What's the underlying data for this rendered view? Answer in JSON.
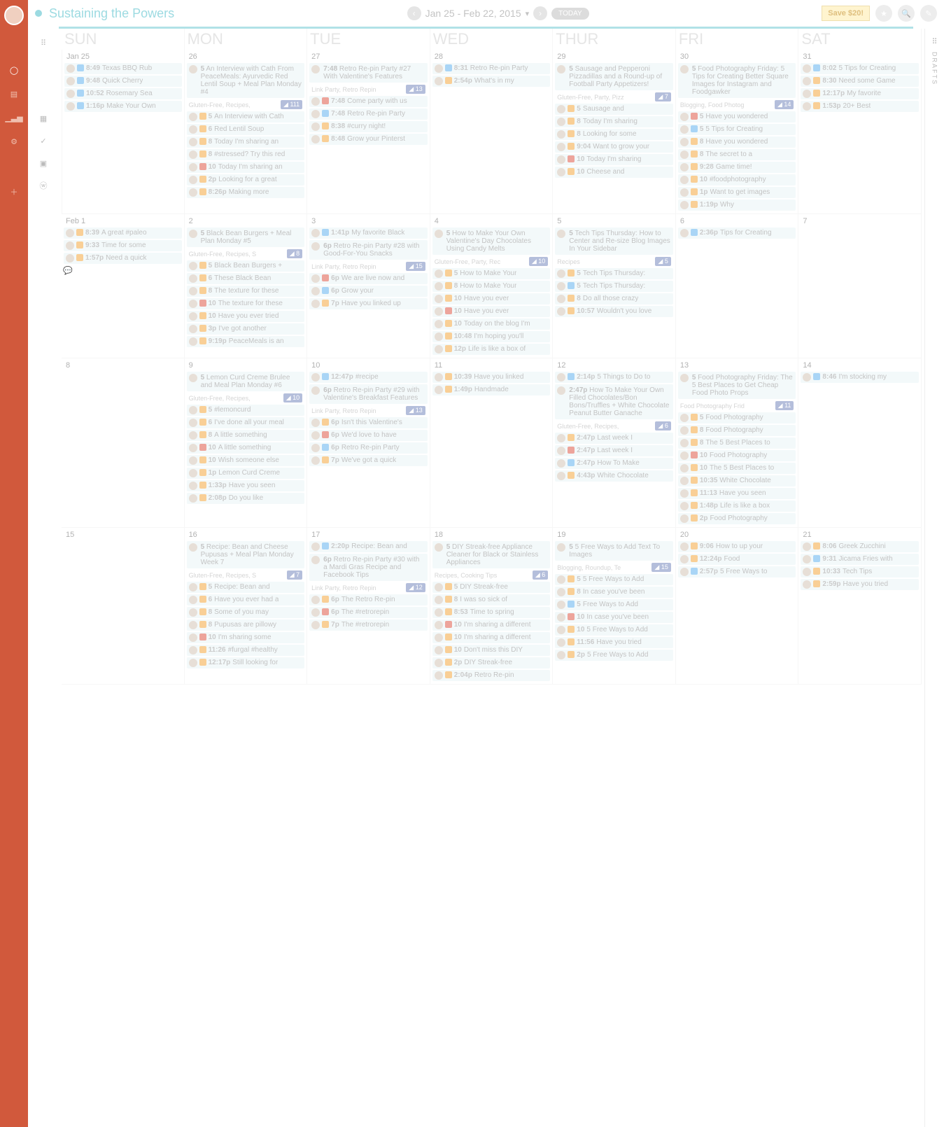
{
  "site_title": "Sustaining the Powers",
  "date_range": "Jan 25 - Feb 22, 2015",
  "today_label": "TODAY",
  "save_label": "Save $20!",
  "drafts_label": "DRAFTS",
  "weekdays": [
    "SUN",
    "MON",
    "TUE",
    "WED",
    "THUR",
    "FRI",
    "SAT"
  ],
  "weeks": [
    {
      "days": [
        {
          "label": "Jan 25",
          "items": [
            {
              "t": "8:49",
              "txt": "Texas BBQ Rub",
              "ic": "tw"
            },
            {
              "t": "9:48",
              "txt": "Quick Cherry",
              "ic": "tw"
            },
            {
              "t": "10:52",
              "txt": "Rosemary Sea",
              "ic": "tw"
            },
            {
              "t": "1:16p",
              "txt": "Make Your Own",
              "ic": "tw"
            }
          ]
        },
        {
          "label": "26",
          "feat": {
            "n": "5",
            "txt": "An Interview with Cath From PeaceMeals: Ayurvedic Red Lentil Soup + Meal Plan Monday #4"
          },
          "tags": "Gluten-Free, Recipes,",
          "badge": "111",
          "items": [
            {
              "t": "5",
              "txt": "An Interview with Cath"
            },
            {
              "t": "6",
              "txt": "Red Lentil Soup"
            },
            {
              "t": "8",
              "txt": "Today I'm sharing an"
            },
            {
              "t": "8",
              "txt": "#stressed? Try this red"
            },
            {
              "t": "10",
              "txt": "Today I'm sharing an",
              "ic": "gp"
            },
            {
              "t": "2p",
              "txt": "Looking for a great"
            },
            {
              "t": "8:26p",
              "txt": "Making more"
            }
          ]
        },
        {
          "label": "27",
          "feat": {
            "n": "7:48",
            "txt": "Retro Re-pin Party #27 With Valentine's Features"
          },
          "tags": "Link Party, Retro Repin",
          "badge": "13",
          "items": [
            {
              "t": "7:48",
              "txt": "Come party with us",
              "ic": "gp"
            },
            {
              "t": "7:48",
              "txt": "Retro Re-pin Party",
              "ic": "tw"
            },
            {
              "t": "8:38",
              "txt": "#curry night!"
            },
            {
              "t": "8:48",
              "txt": "Grow your Pinterst"
            }
          ]
        },
        {
          "label": "28",
          "items": [
            {
              "t": "8:31",
              "txt": "Retro Re-pin Party",
              "ic": "tw"
            },
            {
              "t": "2:54p",
              "txt": "What's in my"
            }
          ]
        },
        {
          "label": "29",
          "feat": {
            "n": "5",
            "txt": "Sausage and Pepperoni Pizzadillas and a Round-up of Football Party Appetizers!"
          },
          "tags": "Gluten-Free, Party, Pizz",
          "badge": "7",
          "items": [
            {
              "t": "5",
              "txt": "Sausage and"
            },
            {
              "t": "8",
              "txt": "Today I'm sharing"
            },
            {
              "t": "8",
              "txt": "Looking for some"
            },
            {
              "t": "9:04",
              "txt": "Want to grow your"
            },
            {
              "t": "10",
              "txt": "Today I'm sharing",
              "ic": "gp"
            },
            {
              "t": "10",
              "txt": "Cheese and"
            }
          ]
        },
        {
          "label": "30",
          "feat": {
            "n": "5",
            "txt": "Food Photography Friday: 5 Tips for Creating Better Square Images for Instagram and Foodgawker"
          },
          "tags": "Blogging, Food Photog",
          "badge": "14",
          "items": [
            {
              "t": "5",
              "txt": "Have you wondered",
              "ic": "gp"
            },
            {
              "t": "5",
              "txt": "5 Tips for Creating",
              "ic": "tw"
            },
            {
              "t": "8",
              "txt": "Have you wondered"
            },
            {
              "t": "8",
              "txt": "The secret to a"
            },
            {
              "t": "9:28",
              "txt": "Game time!"
            },
            {
              "t": "10",
              "txt": "#foodphotography"
            },
            {
              "t": "1p",
              "txt": "Want to get images"
            },
            {
              "t": "1:19p",
              "txt": "Why"
            }
          ]
        },
        {
          "label": "31",
          "items": [
            {
              "t": "8:02",
              "txt": "5 Tips for Creating",
              "ic": "tw"
            },
            {
              "t": "8:30",
              "txt": "Need some Game"
            },
            {
              "t": "12:17p",
              "txt": "My favorite"
            },
            {
              "t": "1:53p",
              "txt": "20+ Best"
            }
          ]
        }
      ]
    },
    {
      "days": [
        {
          "label": "Feb 1",
          "items": [
            {
              "t": "8:39",
              "txt": "A great #paleo"
            },
            {
              "t": "9:33",
              "txt": "Time for some"
            },
            {
              "t": "1:57p",
              "txt": "Need a quick"
            }
          ]
        },
        {
          "label": "2",
          "feat": {
            "n": "5",
            "txt": "Black Bean Burgers + Meal Plan Monday #5"
          },
          "tags": "Gluten-Free, Recipes, S",
          "badge": "8",
          "items": [
            {
              "t": "5",
              "txt": "Black Bean Burgers +"
            },
            {
              "t": "6",
              "txt": "These Black Bean"
            },
            {
              "t": "8",
              "txt": "The texture for these"
            },
            {
              "t": "10",
              "txt": "The texture for these",
              "ic": "gp"
            },
            {
              "t": "10",
              "txt": "Have you ever tried"
            },
            {
              "t": "3p",
              "txt": "I've got another"
            },
            {
              "t": "9:19p",
              "txt": "PeaceMeals is an"
            }
          ]
        },
        {
          "label": "3",
          "items": [
            {
              "t": "1:41p",
              "txt": "My favorite Black",
              "ic": "tw"
            }
          ],
          "feat": {
            "n": "6p",
            "txt": "Retro Re-pin Party #28 with Good-For-You Snacks"
          },
          "tags": "Link Party, Retro Repin",
          "badge": "15",
          "extras": [
            {
              "t": "6p",
              "txt": "We are live now and",
              "ic": "gp"
            },
            {
              "t": "6p",
              "txt": "Grow your",
              "ic": "tw"
            },
            {
              "t": "7p",
              "txt": "Have you linked up"
            }
          ]
        },
        {
          "label": "4",
          "feat": {
            "n": "5",
            "txt": "How to Make Your Own Valentine's Day Chocolates Using Candy Melts"
          },
          "tags": "Gluten-Free, Party, Rec",
          "badge": "10",
          "items": [
            {
              "t": "5",
              "txt": "How to Make Your"
            },
            {
              "t": "8",
              "txt": "How to Make Your"
            },
            {
              "t": "10",
              "txt": "Have you ever"
            },
            {
              "t": "10",
              "txt": "Have you ever",
              "ic": "gp"
            },
            {
              "t": "10",
              "txt": "Today on the blog I'm"
            },
            {
              "t": "10:48",
              "txt": "I'm hoping you'll"
            },
            {
              "t": "12p",
              "txt": "Life is like a box of"
            }
          ]
        },
        {
          "label": "5",
          "feat": {
            "n": "5",
            "txt": "Tech Tips Thursday: How to Center and Re-size Blog Images In Your Sidebar"
          },
          "tags": "Recipes",
          "badge": "5",
          "items": [
            {
              "t": "5",
              "txt": "Tech Tips Thursday:"
            },
            {
              "t": "5",
              "txt": "Tech Tips Thursday:",
              "ic": "tw"
            },
            {
              "t": "8",
              "txt": "Do all those crazy"
            },
            {
              "t": "10:57",
              "txt": "Wouldn't you love"
            }
          ]
        },
        {
          "label": "6",
          "items": [
            {
              "t": "2:36p",
              "txt": "Tips for Creating",
              "ic": "tw"
            }
          ]
        },
        {
          "label": "7",
          "items": []
        }
      ]
    },
    {
      "days": [
        {
          "label": "8",
          "items": []
        },
        {
          "label": "9",
          "feat": {
            "n": "5",
            "txt": "Lemon Curd Creme Brulee and Meal Plan Monday #6"
          },
          "tags": "Gluten-Free, Recipes,",
          "badge": "10",
          "items": [
            {
              "t": "5",
              "txt": "#lemoncurd"
            },
            {
              "t": "6",
              "txt": "I've done all your meal"
            },
            {
              "t": "8",
              "txt": "A little something"
            },
            {
              "t": "10",
              "txt": "A little something",
              "ic": "gp"
            },
            {
              "t": "10",
              "txt": "Wish someone else"
            },
            {
              "t": "1p",
              "txt": "Lemon Curd Creme"
            },
            {
              "t": "1:33p",
              "txt": "Have you seen"
            },
            {
              "t": "2:08p",
              "txt": "Do you like"
            }
          ]
        },
        {
          "label": "10",
          "items": [
            {
              "t": "12:47p",
              "txt": "#recipe",
              "ic": "tw"
            }
          ],
          "feat": {
            "n": "6p",
            "txt": "Retro Re-pin Party #29 with Valentine's Breakfast Features"
          },
          "tags": "Link Party, Retro Repin",
          "badge": "13",
          "extras": [
            {
              "t": "6p",
              "txt": "Isn't this Valentine's"
            },
            {
              "t": "6p",
              "txt": "We'd love to have",
              "ic": "gp"
            },
            {
              "t": "6p",
              "txt": "Retro Re-pin Party",
              "ic": "tw"
            },
            {
              "t": "7p",
              "txt": "We've got a quick"
            }
          ]
        },
        {
          "label": "11",
          "items": [
            {
              "t": "10:39",
              "txt": "Have you linked"
            },
            {
              "t": "1:49p",
              "txt": "Handmade"
            }
          ]
        },
        {
          "label": "12",
          "items": [
            {
              "t": "2:14p",
              "txt": "5 Things to Do to",
              "ic": "tw"
            }
          ],
          "feat": {
            "n": "2:47p",
            "txt": "How To Make Your Own Filled Chocolates/Bon Bons/Truffles + White Chocolate Peanut Butter Ganache"
          },
          "tags": "Gluten-Free, Recipes,",
          "badge": "6",
          "extras": [
            {
              "t": "2:47p",
              "txt": "Last week I"
            },
            {
              "t": "2:47p",
              "txt": "Last week I",
              "ic": "gp"
            },
            {
              "t": "2:47p",
              "txt": "How To Make",
              "ic": "tw"
            },
            {
              "t": "4:43p",
              "txt": "White Chocolate"
            }
          ]
        },
        {
          "label": "13",
          "feat": {
            "n": "5",
            "txt": "Food Photography Friday: The 5 Best Places to Get Cheap Food Photo Props"
          },
          "tags": "Food Photography Frid",
          "badge": "11",
          "items": [
            {
              "t": "5",
              "txt": "Food Photography"
            },
            {
              "t": "8",
              "txt": "Food Photography"
            },
            {
              "t": "8",
              "txt": "The 5 Best Places to"
            },
            {
              "t": "10",
              "txt": "Food Photography",
              "ic": "gp"
            },
            {
              "t": "10",
              "txt": "The 5 Best Places to"
            },
            {
              "t": "10:35",
              "txt": "White Chocolate"
            },
            {
              "t": "11:13",
              "txt": "Have you seen"
            },
            {
              "t": "1:48p",
              "txt": "Life is like a box"
            },
            {
              "t": "2p",
              "txt": "Food Photography"
            }
          ]
        },
        {
          "label": "14",
          "items": [
            {
              "t": "8:46",
              "txt": "I'm stocking my",
              "ic": "tw"
            }
          ]
        }
      ]
    },
    {
      "days": [
        {
          "label": "15",
          "items": []
        },
        {
          "label": "16",
          "feat": {
            "n": "5",
            "txt": "Recipe: Bean and Cheese Pupusas + Meal Plan Monday Week 7"
          },
          "tags": "Gluten-Free, Recipes, S",
          "badge": "7",
          "items": [
            {
              "t": "5",
              "txt": "Recipe: Bean and"
            },
            {
              "t": "6",
              "txt": "Have you ever had a"
            },
            {
              "t": "8",
              "txt": "Some of you may"
            },
            {
              "t": "8",
              "txt": "Pupusas are pillowy"
            },
            {
              "t": "10",
              "txt": "I'm sharing some",
              "ic": "gp"
            },
            {
              "t": "11:26",
              "txt": "#furgal #healthy"
            },
            {
              "t": "12:17p",
              "txt": "Still looking for"
            }
          ]
        },
        {
          "label": "17",
          "items": [
            {
              "t": "2:20p",
              "txt": "Recipe: Bean and",
              "ic": "tw"
            }
          ],
          "feat": {
            "n": "6p",
            "txt": "Retro Re-pin Party #30 with a Mardi Gras Recipe and Facebook Tips"
          },
          "tags": "Link Party, Retro Repin",
          "badge": "12",
          "extras": [
            {
              "t": "6p",
              "txt": "The Retro Re-pin"
            },
            {
              "t": "6p",
              "txt": "The #retrorepin",
              "ic": "gp"
            },
            {
              "t": "7p",
              "txt": "The #retrorepin"
            }
          ]
        },
        {
          "label": "18",
          "feat": {
            "n": "5",
            "txt": "DIY Streak-free Appliance Cleaner for Black or Stainless Appliances"
          },
          "tags": "Recipes, Cooking Tips",
          "badge": "6",
          "items": [
            {
              "t": "5",
              "txt": "DIY Streak-free"
            },
            {
              "t": "8",
              "txt": "I was so sick of"
            },
            {
              "t": "8:53",
              "txt": "Time to spring"
            },
            {
              "t": "10",
              "txt": "I'm sharing a different",
              "ic": "gp"
            },
            {
              "t": "10",
              "txt": "I'm sharing a different"
            },
            {
              "t": "10",
              "txt": "Don't miss this DIY"
            },
            {
              "t": "2p",
              "txt": "DIY Streak-free"
            },
            {
              "t": "2:04p",
              "txt": "Retro Re-pin"
            }
          ]
        },
        {
          "label": "19",
          "feat": {
            "n": "5",
            "txt": "5 Free Ways to Add Text To Images"
          },
          "tags": "Blogging, Roundup, Te",
          "badge": "15",
          "items": [
            {
              "t": "5",
              "txt": "5 Free Ways to Add"
            },
            {
              "t": "8",
              "txt": "In case you've been"
            },
            {
              "t": "5",
              "txt": "Free Ways to Add",
              "ic": "tw"
            },
            {
              "t": "10",
              "txt": "In case you've been",
              "ic": "gp"
            },
            {
              "t": "10",
              "txt": "5 Free Ways to Add"
            },
            {
              "t": "11:56",
              "txt": "Have you tried"
            },
            {
              "t": "2p",
              "txt": "5 Free Ways to Add"
            }
          ]
        },
        {
          "label": "20",
          "items": [
            {
              "t": "9:06",
              "txt": "How to up your"
            },
            {
              "t": "12:24p",
              "txt": "Food"
            },
            {
              "t": "2:57p",
              "txt": "5 Free Ways to",
              "ic": "tw"
            }
          ]
        },
        {
          "label": "21",
          "items": [
            {
              "t": "8:06",
              "txt": "Greek Zucchini"
            },
            {
              "t": "9:31",
              "txt": "Jicama Fries with",
              "ic": "tw"
            },
            {
              "t": "10:33",
              "txt": "Tech Tips"
            },
            {
              "t": "2:59p",
              "txt": "Have you tried"
            }
          ]
        }
      ]
    }
  ]
}
